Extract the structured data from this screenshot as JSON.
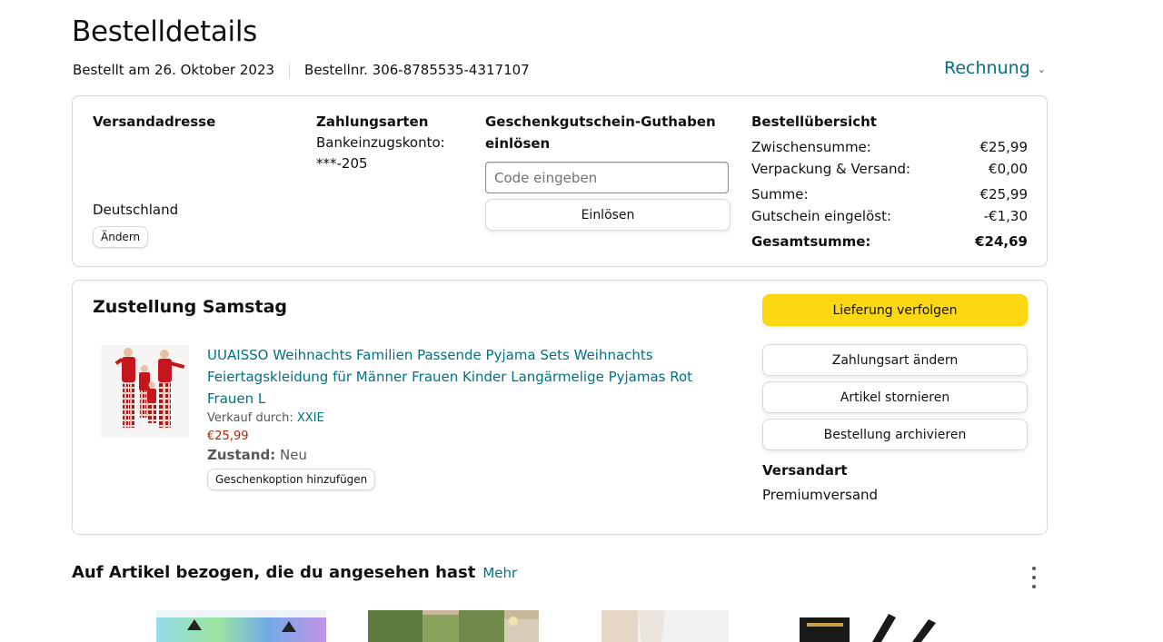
{
  "page": {
    "title": "Bestelldetails",
    "order_date": "Bestellt am 26. Oktober 2023",
    "order_number": "Bestellnr. 306-8785535-4317107",
    "invoice_label": "Rechnung"
  },
  "address": {
    "heading": "Versandadresse",
    "country": "Deutschland",
    "change_label": "Ändern"
  },
  "payment": {
    "heading": "Zahlungsarten",
    "method": "Bankeinzugskonto:",
    "account": "***-205"
  },
  "giftcard": {
    "heading_line1": "Geschenkgutschein-Guthaben",
    "heading_line2": "einlösen",
    "placeholder": "Code eingeben",
    "redeem_label": "Einlösen"
  },
  "summary": {
    "heading": "Bestellübersicht",
    "rows": [
      {
        "label": "Zwischensumme:",
        "value": "€25,99"
      },
      {
        "label": "Verpackung & Versand:",
        "value": "€0,00"
      },
      {
        "label": "Summe:",
        "value": "€25,99"
      },
      {
        "label": "Gutschein eingelöst:",
        "value": "-€1,30"
      },
      {
        "label": "Gesamtsumme:",
        "value": "€24,69"
      }
    ]
  },
  "delivery": {
    "heading": "Zustellung Samstag",
    "product": {
      "title": "UUAISSO Weihnachts Familien Passende Pyjama Sets Weihnachts Feiertagskleidung für Männer Frauen Kinder Langärmelige Pyjamas Rot Frauen L",
      "sold_by_label": "Verkauf durch:",
      "seller": "XXIE",
      "price": "€25,99",
      "condition_label": "Zustand:",
      "condition": "Neu",
      "gift_label": "Geschenkoption hinzufügen"
    },
    "actions": {
      "track": "Lieferung verfolgen",
      "change_payment": "Zahlungsart ändern",
      "cancel": "Artikel stornieren",
      "archive": "Bestellung archivieren"
    },
    "shipping_heading": "Versandart",
    "shipping_method": "Premiumversand"
  },
  "related": {
    "heading": "Auf Artikel bezogen, die du angesehen hast",
    "more_label": "Mehr"
  },
  "colors": {
    "link": "#007185",
    "primary_button": "#ffd814",
    "price": "#b12704",
    "border": "#d5d9d9"
  }
}
